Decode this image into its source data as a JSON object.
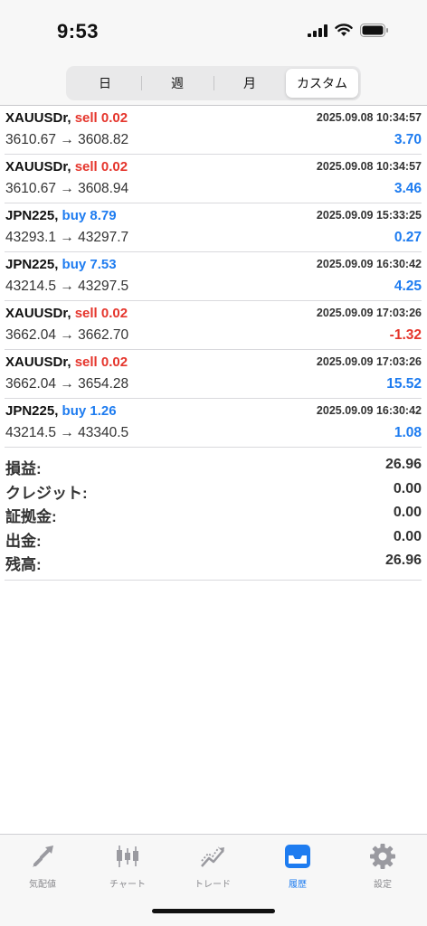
{
  "status_bar": {
    "time": "9:53",
    "icons": [
      "cellular-signal-icon",
      "wifi-icon",
      "battery-icon"
    ]
  },
  "segments": [
    {
      "label": "日",
      "selected": false
    },
    {
      "label": "週",
      "selected": false
    },
    {
      "label": "月",
      "selected": false
    },
    {
      "label": "カスタム",
      "selected": true
    }
  ],
  "trades": [
    {
      "symbol": "XAUUSDr,",
      "side": "sell 0.02",
      "side_type": "sell",
      "time": "2025.09.08 10:34:57",
      "prices": "3610.67 → 3608.82",
      "profit": "3.70",
      "profit_sign": "pos"
    },
    {
      "symbol": "XAUUSDr,",
      "side": "sell 0.02",
      "side_type": "sell",
      "time": "2025.09.08 10:34:57",
      "prices": "3610.67 → 3608.94",
      "profit": "3.46",
      "profit_sign": "pos"
    },
    {
      "symbol": "JPN225,",
      "side": "buy 8.79",
      "side_type": "buy",
      "time": "2025.09.09 15:33:25",
      "prices": "43293.1 → 43297.7",
      "profit": "0.27",
      "profit_sign": "pos"
    },
    {
      "symbol": "JPN225,",
      "side": "buy 7.53",
      "side_type": "buy",
      "time": "2025.09.09 16:30:42",
      "prices": "43214.5 → 43297.5",
      "profit": "4.25",
      "profit_sign": "pos"
    },
    {
      "symbol": "XAUUSDr,",
      "side": "sell 0.02",
      "side_type": "sell",
      "time": "2025.09.09 17:03:26",
      "prices": "3662.04 → 3662.70",
      "profit": "-1.32",
      "profit_sign": "neg"
    },
    {
      "symbol": "XAUUSDr,",
      "side": "sell 0.02",
      "side_type": "sell",
      "time": "2025.09.09 17:03:26",
      "prices": "3662.04 → 3654.28",
      "profit": "15.52",
      "profit_sign": "pos"
    },
    {
      "symbol": "JPN225,",
      "side": "buy 1.26",
      "side_type": "buy",
      "time": "2025.09.09 16:30:42",
      "prices": "43214.5 → 43340.5",
      "profit": "1.08",
      "profit_sign": "pos"
    }
  ],
  "summary": [
    {
      "label": "損益:",
      "value": "26.96"
    },
    {
      "label": "クレジット:",
      "value": "0.00"
    },
    {
      "label": "証拠金:",
      "value": "0.00"
    },
    {
      "label": "出金:",
      "value": "0.00"
    },
    {
      "label": "残高:",
      "value": "26.96"
    }
  ],
  "tabs": [
    {
      "label": "気配値",
      "icon": "quotes-arrows-icon",
      "active": false
    },
    {
      "label": "チャート",
      "icon": "candlestick-chart-icon",
      "active": false
    },
    {
      "label": "トレード",
      "icon": "trade-trend-icon",
      "active": false
    },
    {
      "label": "履歴",
      "icon": "history-inbox-icon",
      "active": true
    },
    {
      "label": "設定",
      "icon": "gear-icon",
      "active": false
    }
  ],
  "colors": {
    "sell": "#e5352c",
    "buy": "#1e7cf0",
    "profit_positive": "#1e7cf0",
    "profit_negative": "#e5352c",
    "active_tab": "#1e7cf0",
    "inactive_tab": "#8a8a8e"
  }
}
